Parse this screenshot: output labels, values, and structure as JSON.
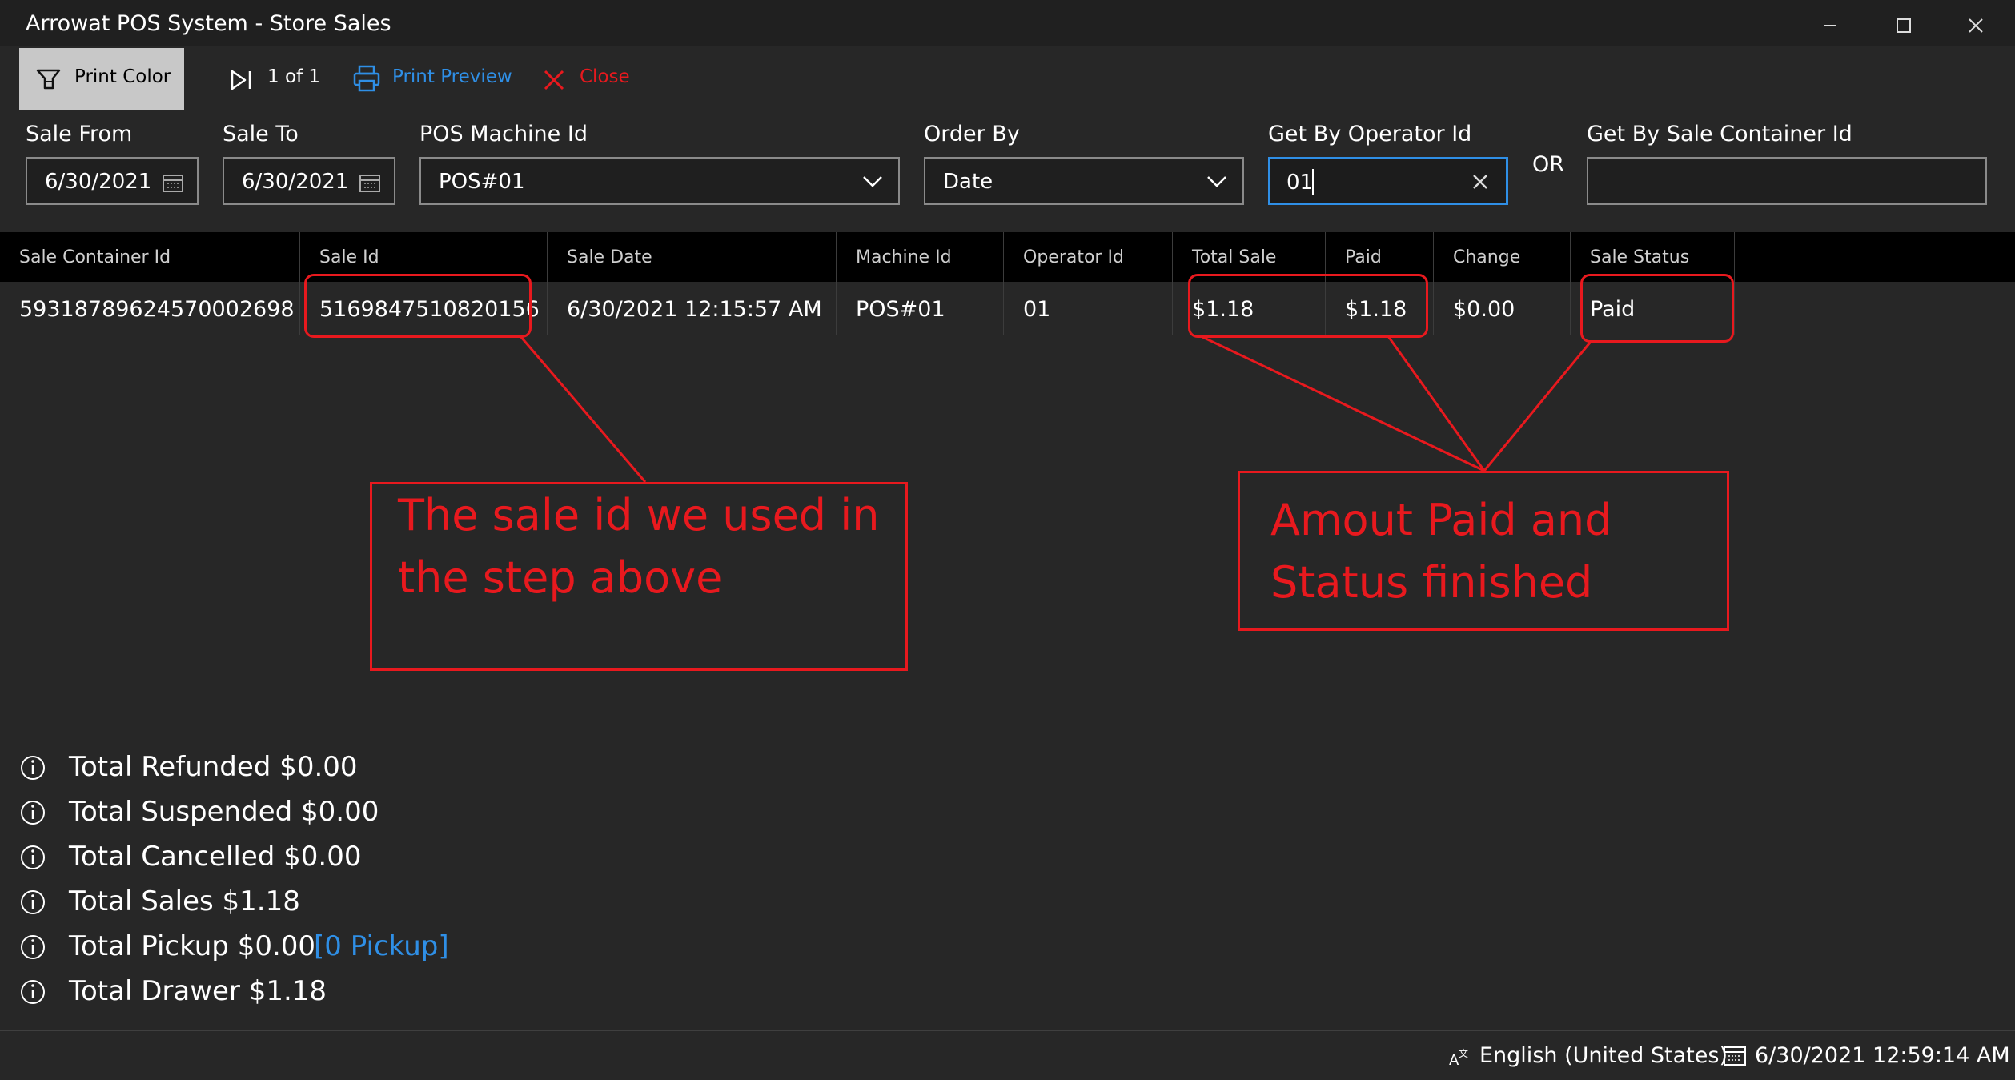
{
  "window": {
    "title": "Arrowat POS System - Store Sales"
  },
  "toolbar": {
    "print_color": "Print Color",
    "page_indicator": "1 of 1",
    "print_preview": "Print Preview",
    "close": "Close"
  },
  "filters": {
    "sale_from": {
      "label": "Sale From",
      "value": "6/30/2021"
    },
    "sale_to": {
      "label": "Sale To",
      "value": "6/30/2021"
    },
    "pos_machine": {
      "label": "POS Machine Id",
      "value": "POS#01"
    },
    "order_by": {
      "label": "Order By",
      "value": "Date"
    },
    "operator": {
      "label": "Get By Operator Id",
      "value": "01"
    },
    "or_label": "OR",
    "container": {
      "label": "Get By Sale Container Id",
      "value": ""
    }
  },
  "grid": {
    "columns": [
      "Sale Container Id",
      "Sale Id",
      "Sale Date",
      "Machine Id",
      "Operator Id",
      "Total Sale",
      "Paid",
      "Change",
      "Sale Status"
    ],
    "rows": [
      [
        "59318789624570002698",
        "5169847510820156",
        "6/30/2021 12:15:57 AM",
        "POS#01",
        "01",
        "$1.18",
        "$1.18",
        "$0.00",
        "Paid"
      ]
    ]
  },
  "annotations": {
    "sale_id_note": [
      "The sale id we used in",
      "the step above"
    ],
    "paid_note": [
      "Amout Paid and",
      "Status finished"
    ]
  },
  "summary": {
    "refunded": "Total Refunded $0.00",
    "suspended": "Total Suspended $0.00",
    "cancelled": "Total Cancelled $0.00",
    "sales": "Total Sales $1.18",
    "pickup": "Total Pickup $0.00",
    "pickup_link": "[0 Pickup]",
    "drawer": "Total Drawer $1.18"
  },
  "status_bar": {
    "language": "English (United States)",
    "datetime": "6/30/2021 12:59:14 AM"
  },
  "colors": {
    "background": "#272727",
    "accent_blue": "#2f8fe6",
    "close_red": "#e8191e",
    "annotation_red": "#e8191e"
  }
}
